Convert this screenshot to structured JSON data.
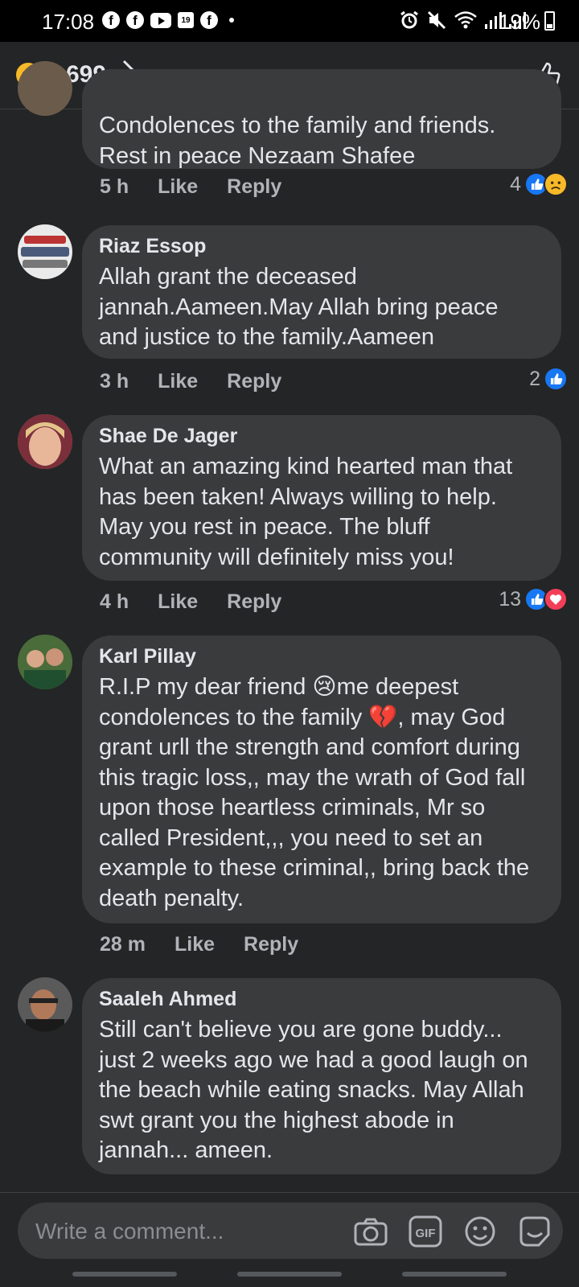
{
  "status_bar": {
    "time": "17:08",
    "battery": "19%"
  },
  "header": {
    "reaction_count": "699"
  },
  "comments": [
    {
      "name": "",
      "text": "Condolences to the family and friends. Rest in peace Nezaam Shafee",
      "time": "5 h",
      "like": "Like",
      "reply": "Reply",
      "reaction_count": "4",
      "reactions": [
        "like",
        "sad"
      ]
    },
    {
      "name": "Riaz Essop",
      "text": "Allah grant the deceased jannah.Aameen.May Allah bring peace and justice to the family.Aameen",
      "time": "3 h",
      "like": "Like",
      "reply": "Reply",
      "reaction_count": "2",
      "reactions": [
        "like"
      ]
    },
    {
      "name": "Shae De Jager",
      "text": "What an amazing kind hearted man that has been taken! Always willing to help. May you rest in peace. The bluff community will definitely miss you!",
      "time": "4 h",
      "like": "Like",
      "reply": "Reply",
      "reaction_count": "13",
      "reactions": [
        "like",
        "love"
      ]
    },
    {
      "name": "Karl Pillay",
      "text_parts": [
        "R.I.P my dear friend ",
        "😢",
        "me deepest condolences to the family ",
        "💔",
        ", may God grant urll the strength and comfort during this tragic loss,, may the wrath of God fall upon those heartless criminals, Mr so called President,,, you need to set an example to these criminal,, bring back the death penalty."
      ],
      "time": "28 m",
      "like": "Like",
      "reply": "Reply"
    },
    {
      "name": "Saaleh Ahmed",
      "text": "Still can't believe you are gone buddy... just 2 weeks ago we had a good laugh on the beach while eating snacks. May Allah swt grant you the highest abode in jannah... ameen."
    }
  ],
  "composer": {
    "placeholder": "Write a comment..."
  },
  "icons": {
    "header": [
      "sad-reaction-icon",
      "like-reaction-icon",
      "chevron-right-icon",
      "thumbs-up-icon"
    ],
    "composer": [
      "camera-icon",
      "gif-icon",
      "emoji-icon",
      "sticker-icon"
    ]
  },
  "colors": {
    "background": "#242526",
    "bubble": "#3a3b3c",
    "like_blue": "#1877f2",
    "love_red": "#f33e58",
    "sad_yellow": "#f7b928"
  }
}
